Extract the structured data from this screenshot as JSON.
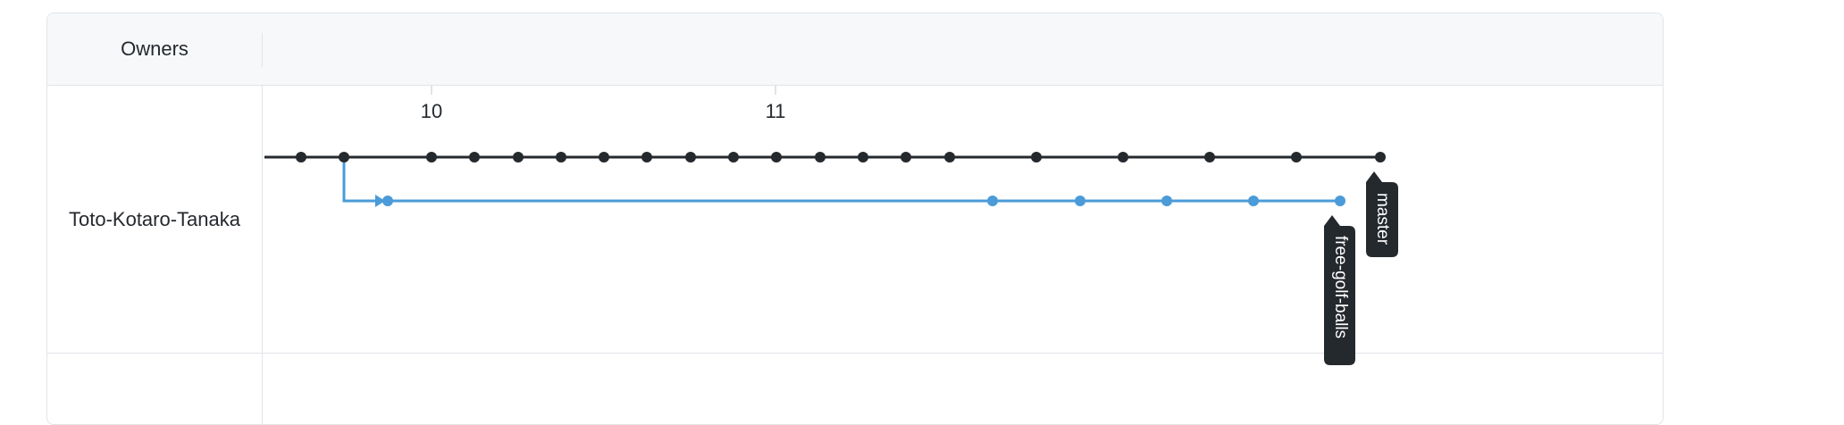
{
  "header": {
    "owners_label": "Owners"
  },
  "network": {
    "owner": "Toto-Kotaro-Tanaka",
    "date_labels": [
      "10",
      "11"
    ],
    "branches": [
      {
        "name": "master",
        "color": "#24292e"
      },
      {
        "name": "free-golf-balls",
        "color": "#4a9bd8"
      }
    ],
    "icons": {
      "commit": "commit-dot-icon",
      "branch_arrow": "branch-arrow-icon"
    }
  }
}
